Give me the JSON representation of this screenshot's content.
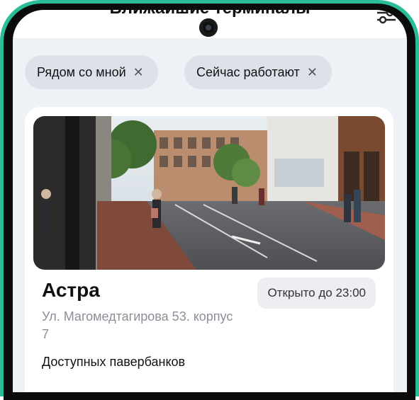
{
  "header": {
    "title": "Ближайшие терминалы",
    "action_icon": "filter-icon"
  },
  "chips": [
    {
      "label": "Рядом со мной",
      "icon": "close-icon"
    },
    {
      "label": "Сейчас работают",
      "icon": "close-icon"
    }
  ],
  "terminal": {
    "name": "Астра",
    "status": "Открыто до 23:00",
    "address": "Ул. Магомедтагирова 53. корпус 7",
    "available_label": "Доступных павербанков"
  },
  "colors": {
    "frame_accent": "#2bbd9a",
    "screen_bg": "#eef1f5",
    "chip_bg": "#dde2ea",
    "status_bg": "#eceef2",
    "address_text": "#8b9098"
  }
}
